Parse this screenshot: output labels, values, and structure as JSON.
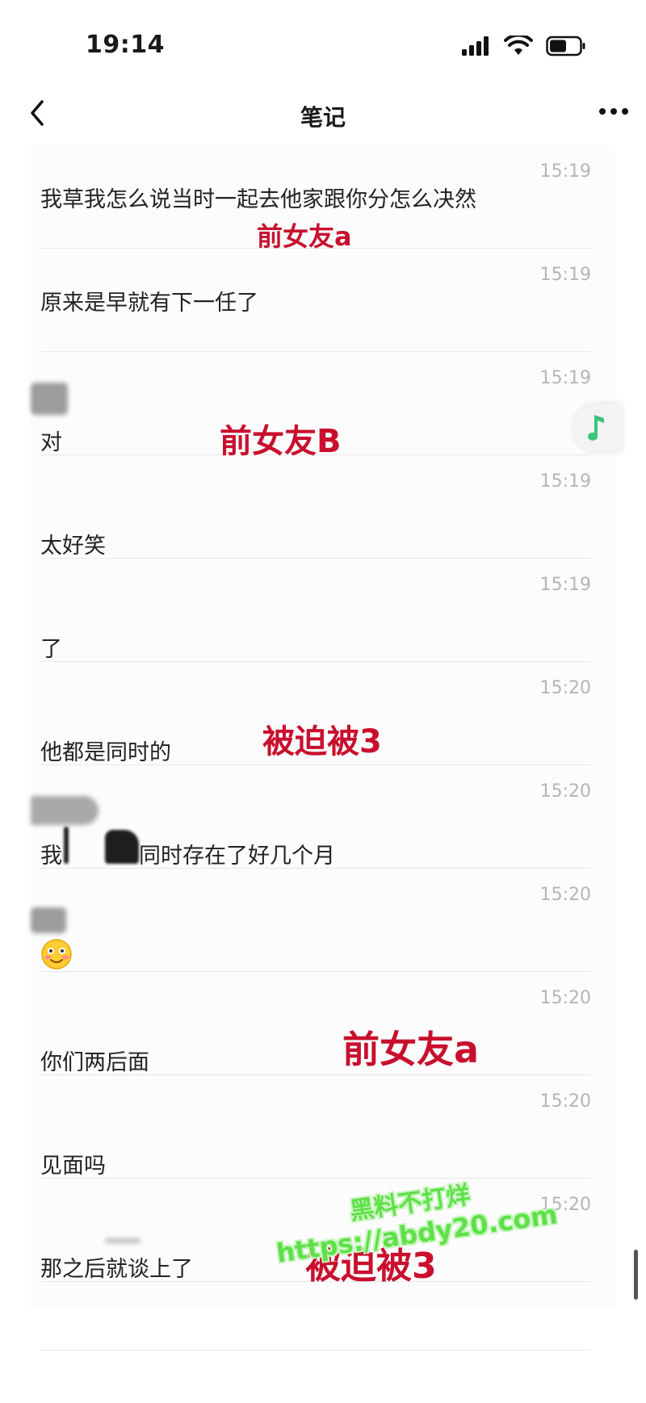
{
  "status": {
    "time": "19:14"
  },
  "nav": {
    "title": "笔记"
  },
  "messages": [
    {
      "time": "15:19",
      "text": "我草我怎么说当时一起去他家跟你分怎么决然"
    },
    {
      "time": "15:19",
      "text": "原来是早就有下一任了"
    },
    {
      "time": "15:19",
      "text": "对"
    },
    {
      "time": "15:19",
      "text": "太好笑"
    },
    {
      "time": "15:19",
      "text": "了"
    },
    {
      "time": "15:20",
      "text": "他都是同时的"
    },
    {
      "time": "15:20",
      "text_a": "我",
      "text_b": "同时存在了好几个月"
    },
    {
      "time": "15:20",
      "text": ""
    },
    {
      "time": "15:20",
      "text": "你们两后面"
    },
    {
      "time": "15:20",
      "text": "见面吗"
    },
    {
      "time": "15:20",
      "text": "那之后就谈上了"
    }
  ],
  "annotations": {
    "a1": "前女友a",
    "b": "前女友B",
    "c1": "被迫被3",
    "a2": "前女友a",
    "c2": "被迫被3"
  },
  "watermark": {
    "line1": "黑料不打烊",
    "line2": "https://abdy20.com"
  },
  "colors": {
    "annotation": "#c8102e",
    "watermark": "#5fe04a",
    "music_note": "#3cc47c"
  },
  "icons": {
    "back": "chevron-left-icon",
    "more": "more-dots-icon",
    "music": "music-note-icon",
    "emoji": "blushing-smile-emoji"
  }
}
